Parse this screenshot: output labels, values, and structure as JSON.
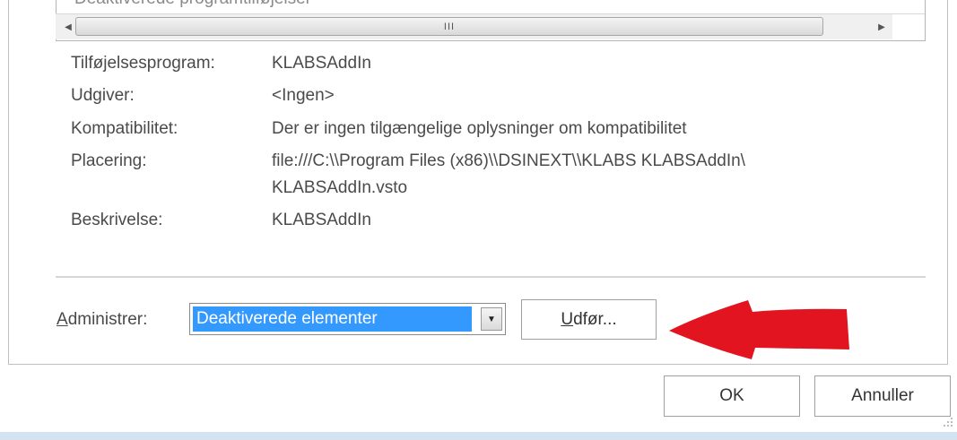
{
  "list": {
    "cut_text": "Deaktiverede programtilføjelser"
  },
  "scrollbar": {
    "left_arrow": "◀",
    "right_arrow": "▶",
    "grip": "III"
  },
  "details": [
    {
      "label": "Tilføjelsesprogram:",
      "value": "KLABSAddIn"
    },
    {
      "label": "Udgiver:",
      "value": "<Ingen>"
    },
    {
      "label": "Kompatibilitet:",
      "value": "Der er ingen tilgængelige oplysninger om kompatibilitet"
    },
    {
      "label": "Placering:",
      "value": "file:///C:\\\\Program Files (x86)\\\\DSINEXT\\\\KLABS KLABSAddIn\\",
      "value_line2": "KLABSAddIn.vsto"
    },
    {
      "label": "Beskrivelse:",
      "value": "KLABSAddIn"
    }
  ],
  "manage": {
    "label_mnemonic": "A",
    "label_rest": "dministrer:",
    "selected": "Deaktiverede elementer",
    "dropdown_icon": "▼",
    "run_mnemonic": "U",
    "run_rest": "dfør..."
  },
  "dialog": {
    "ok_label": "OK",
    "cancel_label": "Annuller"
  },
  "colors": {
    "selection": "#3399ff",
    "arrow": "#e2141f"
  },
  "icons": {
    "annotation": "red-arrow-icon",
    "dropdown": "chevron-down-icon"
  }
}
